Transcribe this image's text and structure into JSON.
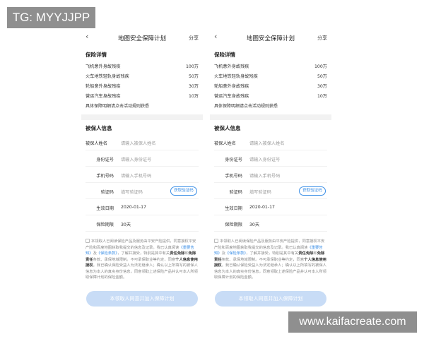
{
  "watermarks": {
    "top": "TG: MYYJJPP",
    "bottom": "www.kaifacreate.com"
  },
  "nav": {
    "back_icon": "chevron-left-icon",
    "title": "地图安全保障计划",
    "share": "分享"
  },
  "plan": {
    "section_title": "保险详情",
    "items": [
      {
        "name": "飞机意外身故残疾",
        "amount": "100万"
      },
      {
        "name": "火车地铁轻轨身故残疾",
        "amount": "50万"
      },
      {
        "name": "轮船意外身故残疾",
        "amount": "30万"
      },
      {
        "name": "营运汽车身故残疾",
        "amount": "10万"
      }
    ],
    "note": "具体保障明细请点击活动规则获悉"
  },
  "insured": {
    "section_title": "被保人信息",
    "name_label": "被保人姓名",
    "name_placeholder": "请输入被保人姓名",
    "id_label": "身份证号",
    "id_placeholder": "请输入身份证号",
    "phone_label": "手机号码",
    "phone_placeholder": "请输入手机号码",
    "code_label": "验证码",
    "code_placeholder": "填写验证码",
    "code_button": "获取验证码",
    "date_label": "生效日期",
    "date_value": "2020-01-17",
    "period_label": "保险期限",
    "period_value": "30天"
  },
  "agreement": {
    "p1": "本领取人已阅读保险产品及服务由平安产险提供，同意授权平安产险和百度地图获取我提交的信息及记录。我已认真阅读",
    "link1": "《重要告知》",
    "and": "及",
    "link2": "《保险条款》",
    "p2": "，了解并接受，特别是其中有关",
    "bold1": "责任免除",
    "p3": "和",
    "bold2": "免除责任",
    "p4": "条款、承保地域限制。不可承保职业等约定，同意",
    "bold3": "个人信息使用授权",
    "p5": "。我已确认保险受益人为法定继承人；确认以上所填写的被保人信息为本人的真实身份信息，同意领取上述保险产品并认可本人所领取保障计划的保险金额。"
  },
  "submit": {
    "label": "本领取人同意并加入保障计划"
  }
}
